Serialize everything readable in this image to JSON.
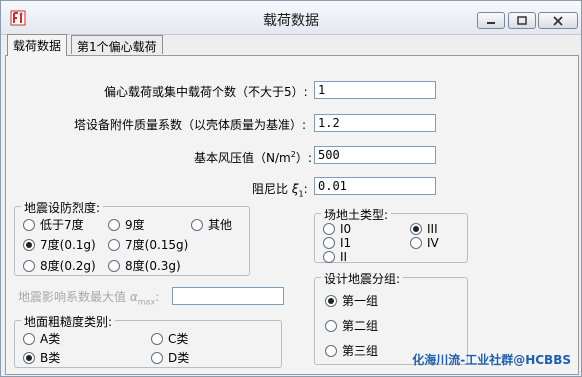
{
  "window": {
    "title": "载荷数据",
    "icon": "app-logo-icon",
    "controls": [
      "minimize-icon",
      "maximize-icon",
      "close-icon"
    ]
  },
  "tabs": [
    {
      "label": "载荷数据",
      "active": true
    },
    {
      "label": "第1个偏心载荷",
      "active": false
    }
  ],
  "fields": {
    "eccentric_count": {
      "label": "偏心载荷或集中载荷个数（不大于5）:",
      "value": "1"
    },
    "mass_coefficient": {
      "label": "塔设备附件质量系数（以壳体质量为基准）:",
      "value": "1.2"
    },
    "wind_pressure": {
      "label_main": "基本风压值（N/m",
      "label_sup": "2",
      "label_end": "）:",
      "value": "500"
    },
    "damping_ratio": {
      "label_main": "阻尼比",
      "label_sym": "ξ",
      "label_sub": "1",
      "label_end": ":",
      "value": "0.01"
    },
    "seismic_max": {
      "label": "地震影响系数最大值",
      "label_sym": "α",
      "label_sub": "max",
      "label_end": ":",
      "value": "",
      "disabled": true
    }
  },
  "seismic_intensity": {
    "legend": "地震设防烈度:",
    "options": [
      {
        "label": "低于7度",
        "checked": false
      },
      {
        "label": "9度",
        "checked": false
      },
      {
        "label": "其他",
        "checked": false
      },
      {
        "label": "7度(0.1g)",
        "checked": true
      },
      {
        "label": "7度(0.15g)",
        "checked": false
      },
      {
        "label": "8度(0.2g)",
        "checked": false
      },
      {
        "label": "8度(0.3g)",
        "checked": false
      }
    ]
  },
  "site_soil": {
    "legend": "场地土类型:",
    "options": [
      {
        "label": "I0",
        "checked": false
      },
      {
        "label": "III",
        "checked": true
      },
      {
        "label": "I1",
        "checked": false
      },
      {
        "label": "IV",
        "checked": false
      },
      {
        "label": "II",
        "checked": false
      }
    ]
  },
  "design_group": {
    "legend": "设计地震分组:",
    "options": [
      {
        "label": "第一组",
        "checked": true
      },
      {
        "label": "第二组",
        "checked": false
      },
      {
        "label": "第三组",
        "checked": false
      }
    ]
  },
  "roughness": {
    "legend": "地面粗糙度类别:",
    "options": [
      {
        "label": "A类",
        "checked": false
      },
      {
        "label": "C类",
        "checked": false
      },
      {
        "label": "B类",
        "checked": true
      },
      {
        "label": "D类",
        "checked": false
      }
    ]
  },
  "watermark": "化海川流-工业社群@HCBBS",
  "colors": {
    "accent": "#1e5fb0",
    "input_border": "#7f9db9"
  }
}
